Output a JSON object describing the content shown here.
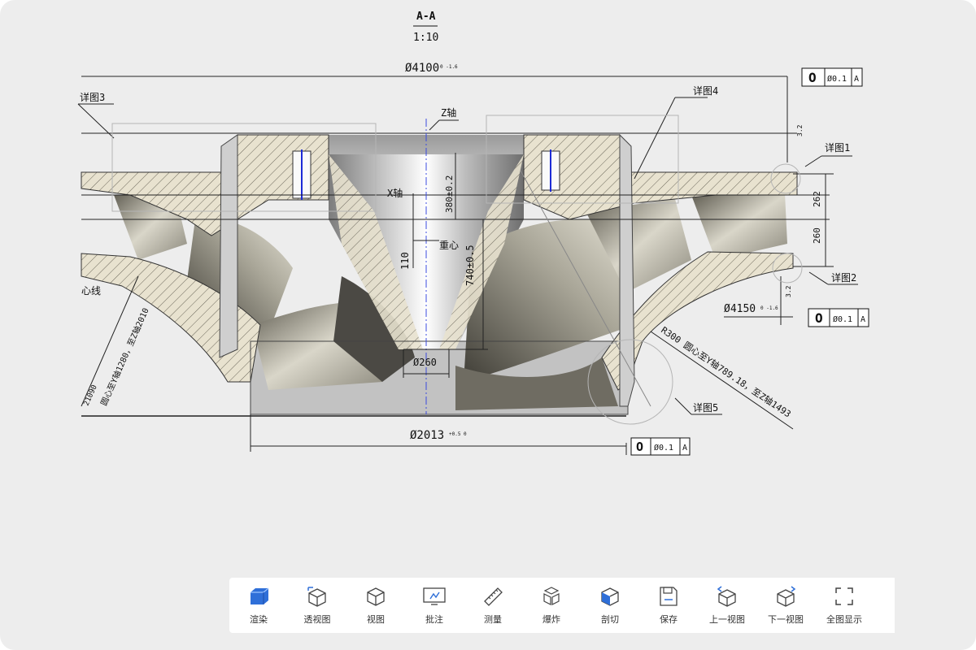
{
  "drawing": {
    "section_label": "A-A",
    "scale": "1:10",
    "dim_top": "Ø4100",
    "dim_top_tol": "0 -1.6",
    "dim_bottom": "Ø2013",
    "dim_bottom_tol": "+0.5 0",
    "dim_right": "Ø4150",
    "dim_right_tol": "0 -1.6",
    "dim_small_dia": "Ø260",
    "dim_380": "380±0.2",
    "dim_740": "740±0.5",
    "dim_110": "110",
    "dim_262": "262",
    "dim_260": "260",
    "label_z_axis": "Z轴",
    "label_x_axis": "X轴",
    "label_cg": "重心",
    "detail_1": "详图1",
    "detail_2": "详图2",
    "detail_3": "详图3",
    "detail_4": "详图4",
    "detail_5": "详图5",
    "radius_note": "R300 圆心至Y轴789.18，至Z轴1493",
    "left_note": "圆心至Y轴1280，至Z轴2010",
    "left_note_top": "21090",
    "left_line_label": "心线",
    "roughness_1": "3.2",
    "roughness_2": "3.2",
    "tol_frame_1": {
      "symbol": "O",
      "value": "Ø0.1",
      "datum": "A"
    },
    "tol_frame_2": {
      "symbol": "O",
      "value": "Ø0.1",
      "datum": "A"
    },
    "tol_frame_3": {
      "symbol": "O",
      "value": "Ø0.1",
      "datum": "A"
    }
  },
  "toolbar": {
    "items": [
      {
        "label": "渲染",
        "icon": "render-cube-icon"
      },
      {
        "label": "透视图",
        "icon": "perspective-cube-icon"
      },
      {
        "label": "视图",
        "icon": "view-cube-icon"
      },
      {
        "label": "批注",
        "icon": "annotation-icon"
      },
      {
        "label": "测量",
        "icon": "ruler-icon"
      },
      {
        "label": "爆炸",
        "icon": "explode-icon"
      },
      {
        "label": "剖切",
        "icon": "section-cube-icon"
      },
      {
        "label": "保存",
        "icon": "save-icon"
      },
      {
        "label": "上一视图",
        "icon": "previous-view-icon"
      },
      {
        "label": "下一视图",
        "icon": "next-view-icon"
      },
      {
        "label": "全图显示",
        "icon": "fullscreen-icon"
      }
    ]
  }
}
